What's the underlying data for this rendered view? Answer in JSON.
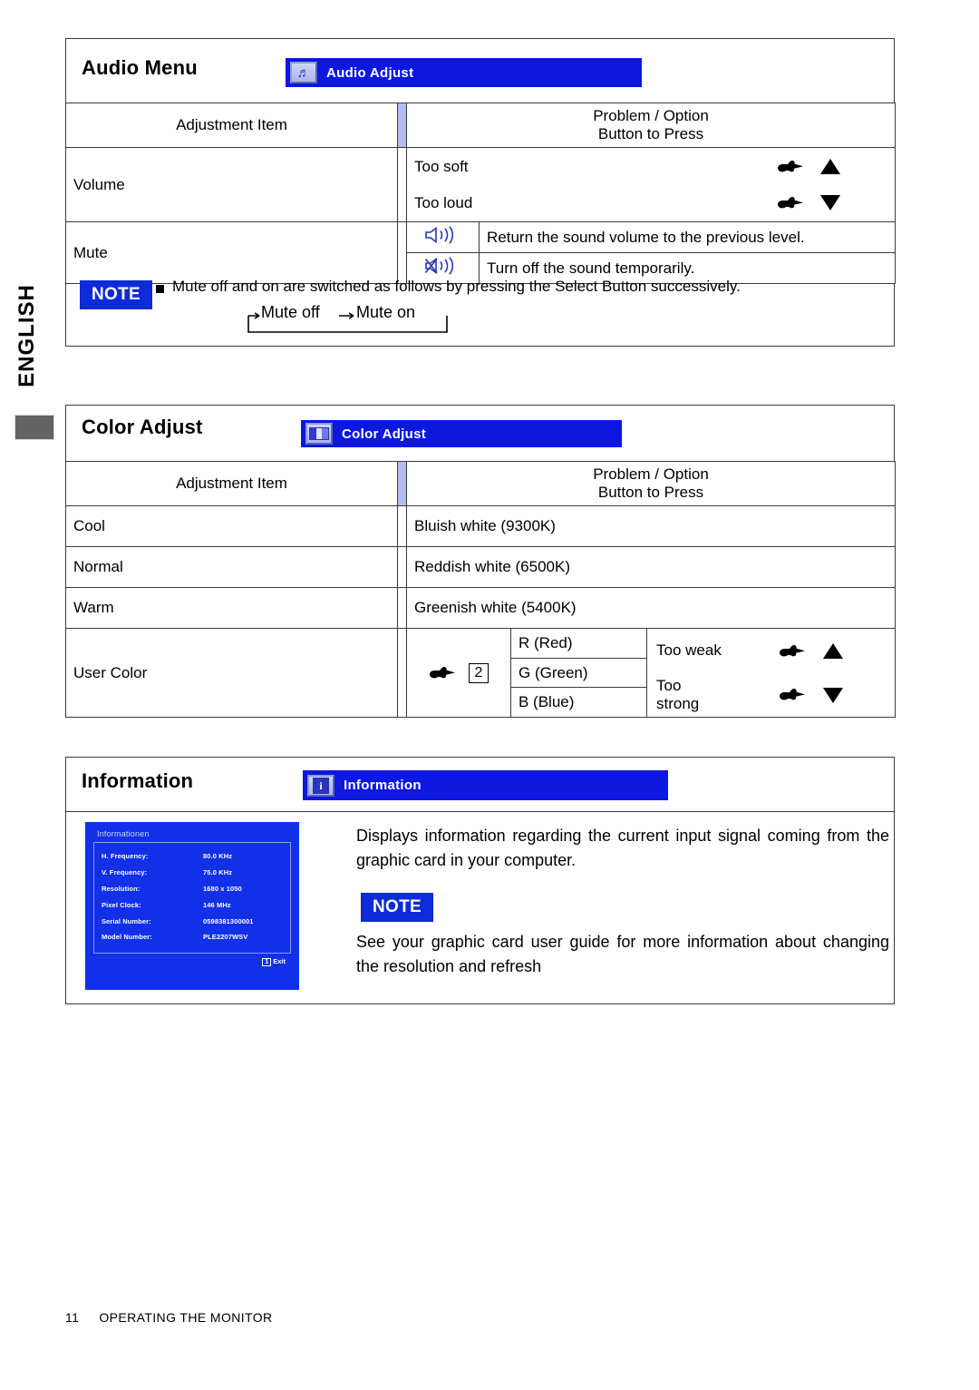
{
  "page": {
    "language_tab": "ENGLISH",
    "footer_page_number": "11",
    "footer_title": "OPERATING THE MONITOR"
  },
  "audio_section": {
    "heading": "Audio Menu",
    "osd_bar_label": "Audio Adjust",
    "osd_bar_icon": "music-note-icon",
    "columns": [
      "Adjustment Item",
      "Problem / Option",
      "Button to Press"
    ],
    "rows": [
      {
        "item": "Volume",
        "options": [
          "Too soft",
          "Too loud"
        ]
      },
      {
        "item": "Mute",
        "sub": [
          {
            "icon": "speaker-on-icon",
            "text": "Return the sound volume to the previous level."
          },
          {
            "icon": "speaker-mute-icon",
            "text": "Turn off the sound temporarily."
          }
        ]
      }
    ],
    "note": {
      "badge": "NOTE",
      "text": "Mute off and on are switched as follows by pressing the Select Button successively.",
      "loop": [
        "Mute off",
        "Mute on"
      ]
    }
  },
  "color_section": {
    "heading": "Color Adjust",
    "osd_bar_label": "Color Adjust",
    "osd_bar_icon": "color-bars-icon",
    "columns": [
      "Adjustment Item",
      "Problem / Option",
      "Button to Press"
    ],
    "rows": [
      {
        "item": "Cool",
        "option": "Bluish white (9300K)"
      },
      {
        "item": "Normal",
        "option": "Reddish white (6500K)"
      },
      {
        "item": "Warm",
        "option": "Greenish white (5400K)"
      }
    ],
    "user_color": {
      "item": "User Color",
      "key": "2",
      "channels": [
        "R (Red)",
        "G (Green)",
        "B (Blue)"
      ],
      "problems": [
        "Too weak",
        "Too strong"
      ]
    }
  },
  "information_section": {
    "heading": "Information",
    "osd_bar_label": "Information",
    "osd_bar_icon": "info-icon",
    "paragraph": "Displays information regarding the current input signal coming from the graphic card in your computer.",
    "note_badge": "NOTE",
    "note_text": "See your graphic card user guide for more information about changing the resolution and refresh",
    "osd_screenshot": {
      "title": "Informationen",
      "rows": [
        {
          "label": "H. Frequency:",
          "value": "80.0 KHz"
        },
        {
          "label": "V. Frequency:",
          "value": "75.0 KHz"
        },
        {
          "label": "Resolution:",
          "value": "1680 x 1050"
        },
        {
          "label": "Pixel Clock:",
          "value": "146 MHz"
        },
        {
          "label": "Serial Number:",
          "value": "0598381300001"
        },
        {
          "label": "Model Number:",
          "value": "PLE2207WSV"
        }
      ],
      "exit_key": "1",
      "exit_label": "Exit"
    }
  },
  "colors": {
    "osd_blue": "#0d17e0",
    "header_lavender": "#b6bdee",
    "note_blue": "#0d2bd8",
    "osd_screenshot_blue": "#1130e8",
    "icon_blue": "#2a34b9"
  }
}
